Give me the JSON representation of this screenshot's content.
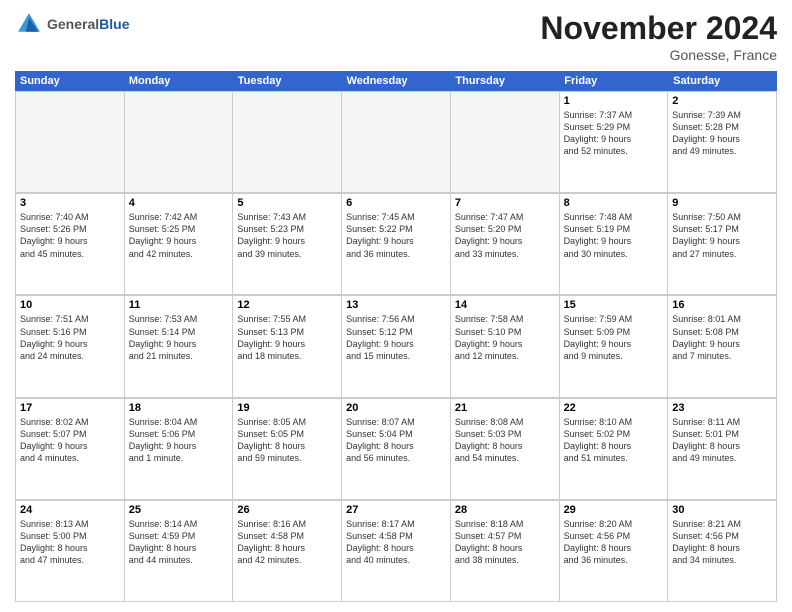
{
  "logo": {
    "general": "General",
    "blue": "Blue"
  },
  "title": "November 2024",
  "location": "Gonesse, France",
  "header_days": [
    "Sunday",
    "Monday",
    "Tuesday",
    "Wednesday",
    "Thursday",
    "Friday",
    "Saturday"
  ],
  "weeks": [
    [
      {
        "day": "",
        "info": ""
      },
      {
        "day": "",
        "info": ""
      },
      {
        "day": "",
        "info": ""
      },
      {
        "day": "",
        "info": ""
      },
      {
        "day": "",
        "info": ""
      },
      {
        "day": "1",
        "info": "Sunrise: 7:37 AM\nSunset: 5:29 PM\nDaylight: 9 hours\nand 52 minutes."
      },
      {
        "day": "2",
        "info": "Sunrise: 7:39 AM\nSunset: 5:28 PM\nDaylight: 9 hours\nand 49 minutes."
      }
    ],
    [
      {
        "day": "3",
        "info": "Sunrise: 7:40 AM\nSunset: 5:26 PM\nDaylight: 9 hours\nand 45 minutes."
      },
      {
        "day": "4",
        "info": "Sunrise: 7:42 AM\nSunset: 5:25 PM\nDaylight: 9 hours\nand 42 minutes."
      },
      {
        "day": "5",
        "info": "Sunrise: 7:43 AM\nSunset: 5:23 PM\nDaylight: 9 hours\nand 39 minutes."
      },
      {
        "day": "6",
        "info": "Sunrise: 7:45 AM\nSunset: 5:22 PM\nDaylight: 9 hours\nand 36 minutes."
      },
      {
        "day": "7",
        "info": "Sunrise: 7:47 AM\nSunset: 5:20 PM\nDaylight: 9 hours\nand 33 minutes."
      },
      {
        "day": "8",
        "info": "Sunrise: 7:48 AM\nSunset: 5:19 PM\nDaylight: 9 hours\nand 30 minutes."
      },
      {
        "day": "9",
        "info": "Sunrise: 7:50 AM\nSunset: 5:17 PM\nDaylight: 9 hours\nand 27 minutes."
      }
    ],
    [
      {
        "day": "10",
        "info": "Sunrise: 7:51 AM\nSunset: 5:16 PM\nDaylight: 9 hours\nand 24 minutes."
      },
      {
        "day": "11",
        "info": "Sunrise: 7:53 AM\nSunset: 5:14 PM\nDaylight: 9 hours\nand 21 minutes."
      },
      {
        "day": "12",
        "info": "Sunrise: 7:55 AM\nSunset: 5:13 PM\nDaylight: 9 hours\nand 18 minutes."
      },
      {
        "day": "13",
        "info": "Sunrise: 7:56 AM\nSunset: 5:12 PM\nDaylight: 9 hours\nand 15 minutes."
      },
      {
        "day": "14",
        "info": "Sunrise: 7:58 AM\nSunset: 5:10 PM\nDaylight: 9 hours\nand 12 minutes."
      },
      {
        "day": "15",
        "info": "Sunrise: 7:59 AM\nSunset: 5:09 PM\nDaylight: 9 hours\nand 9 minutes."
      },
      {
        "day": "16",
        "info": "Sunrise: 8:01 AM\nSunset: 5:08 PM\nDaylight: 9 hours\nand 7 minutes."
      }
    ],
    [
      {
        "day": "17",
        "info": "Sunrise: 8:02 AM\nSunset: 5:07 PM\nDaylight: 9 hours\nand 4 minutes."
      },
      {
        "day": "18",
        "info": "Sunrise: 8:04 AM\nSunset: 5:06 PM\nDaylight: 9 hours\nand 1 minute."
      },
      {
        "day": "19",
        "info": "Sunrise: 8:05 AM\nSunset: 5:05 PM\nDaylight: 8 hours\nand 59 minutes."
      },
      {
        "day": "20",
        "info": "Sunrise: 8:07 AM\nSunset: 5:04 PM\nDaylight: 8 hours\nand 56 minutes."
      },
      {
        "day": "21",
        "info": "Sunrise: 8:08 AM\nSunset: 5:03 PM\nDaylight: 8 hours\nand 54 minutes."
      },
      {
        "day": "22",
        "info": "Sunrise: 8:10 AM\nSunset: 5:02 PM\nDaylight: 8 hours\nand 51 minutes."
      },
      {
        "day": "23",
        "info": "Sunrise: 8:11 AM\nSunset: 5:01 PM\nDaylight: 8 hours\nand 49 minutes."
      }
    ],
    [
      {
        "day": "24",
        "info": "Sunrise: 8:13 AM\nSunset: 5:00 PM\nDaylight: 8 hours\nand 47 minutes."
      },
      {
        "day": "25",
        "info": "Sunrise: 8:14 AM\nSunset: 4:59 PM\nDaylight: 8 hours\nand 44 minutes."
      },
      {
        "day": "26",
        "info": "Sunrise: 8:16 AM\nSunset: 4:58 PM\nDaylight: 8 hours\nand 42 minutes."
      },
      {
        "day": "27",
        "info": "Sunrise: 8:17 AM\nSunset: 4:58 PM\nDaylight: 8 hours\nand 40 minutes."
      },
      {
        "day": "28",
        "info": "Sunrise: 8:18 AM\nSunset: 4:57 PM\nDaylight: 8 hours\nand 38 minutes."
      },
      {
        "day": "29",
        "info": "Sunrise: 8:20 AM\nSunset: 4:56 PM\nDaylight: 8 hours\nand 36 minutes."
      },
      {
        "day": "30",
        "info": "Sunrise: 8:21 AM\nSunset: 4:56 PM\nDaylight: 8 hours\nand 34 minutes."
      }
    ]
  ]
}
